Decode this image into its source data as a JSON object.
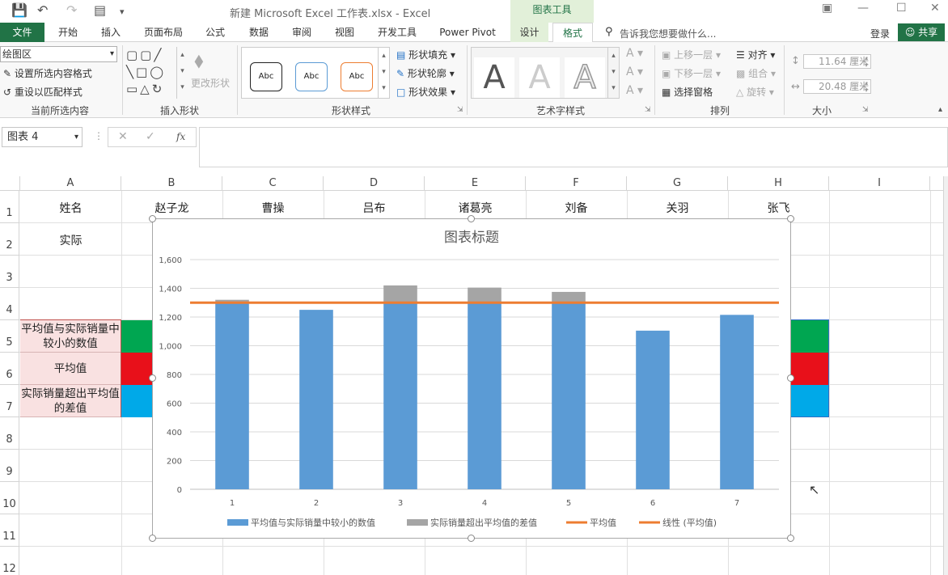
{
  "window": {
    "title": "新建 Microsoft Excel 工作表.xlsx - Excel",
    "context_tab": "图表工具"
  },
  "tabs": [
    "文件",
    "开始",
    "插入",
    "页面布局",
    "公式",
    "数据",
    "审阅",
    "视图",
    "开发工具",
    "Power Pivot",
    "设计",
    "格式"
  ],
  "tell_me": "告诉我您想要做什么...",
  "login": "登录",
  "share": "共享",
  "ribbon": {
    "current_selection": {
      "dropdown": "绘图区",
      "format_selection": "设置所选内容格式",
      "reset_style": "重设以匹配样式",
      "label": "当前所选内容"
    },
    "insert_shapes": {
      "change_shape": "更改形状",
      "label": "插入形状"
    },
    "shape_styles": {
      "sample": "Abc",
      "fill": "形状填充",
      "outline": "形状轮廓",
      "effects": "形状效果",
      "label": "形状样式"
    },
    "wordart": {
      "glyph": "A",
      "label": "艺术字样式"
    },
    "arrange": {
      "bring_forward": "上移一层",
      "send_backward": "下移一层",
      "selection_pane": "选择窗格",
      "align": "对齐",
      "group": "组合",
      "rotate": "旋转",
      "label": "排列"
    },
    "size": {
      "height": "11.64 厘米",
      "width": "20.48 厘米",
      "label": "大小"
    }
  },
  "formula_bar": {
    "name_box": "图表 4",
    "fx": "fx"
  },
  "columns": [
    "A",
    "B",
    "C",
    "D",
    "E",
    "F",
    "G",
    "H",
    "I"
  ],
  "rows": [
    "1",
    "2",
    "3",
    "4",
    "5",
    "6",
    "7",
    "8",
    "9",
    "10",
    "11",
    "12"
  ],
  "cells": {
    "a1": "姓名",
    "names": [
      "赵子龙",
      "曹操",
      "吕布",
      "诸葛亮",
      "刘备",
      "关羽",
      "张飞"
    ],
    "a2": "实际",
    "legend_rows": [
      "平均值与实际销量中较小的数值",
      "平均值",
      "实际销量超出平均值的差值"
    ]
  },
  "colors": {
    "excel_green": "#217346",
    "swatch_green": "#00a651",
    "swatch_red": "#e8101a",
    "swatch_blue": "#00a9e8",
    "bar_blue": "#5b9bd5",
    "bar_gray": "#a5a5a5",
    "line_orange": "#ed7d31"
  },
  "chart_data": {
    "type": "bar",
    "title": "图表标题",
    "categories": [
      "1",
      "2",
      "3",
      "4",
      "5",
      "6",
      "7"
    ],
    "series": [
      {
        "name": "平均值与实际销量中较小的数值",
        "values": [
          1300,
          1250,
          1300,
          1300,
          1300,
          1105,
          1215
        ],
        "color": "#5b9bd5"
      },
      {
        "name": "实际销量超出平均值的差值",
        "values": [
          20,
          0,
          120,
          105,
          75,
          0,
          0
        ],
        "color": "#a5a5a5"
      },
      {
        "name": "平均值",
        "values": [
          1300,
          1300,
          1300,
          1300,
          1300,
          1300,
          1300
        ],
        "color": "#ed7d31",
        "kind": "line"
      },
      {
        "name": "线性 (平均值)",
        "color": "#ed7d31",
        "kind": "trendline"
      }
    ],
    "stacked": true,
    "ylim": [
      0,
      1600
    ],
    "yticks": [
      "0",
      "200",
      "400",
      "600",
      "800",
      "1,000",
      "1,200",
      "1,400",
      "1,600"
    ],
    "grid": true,
    "legend": "bottom"
  }
}
